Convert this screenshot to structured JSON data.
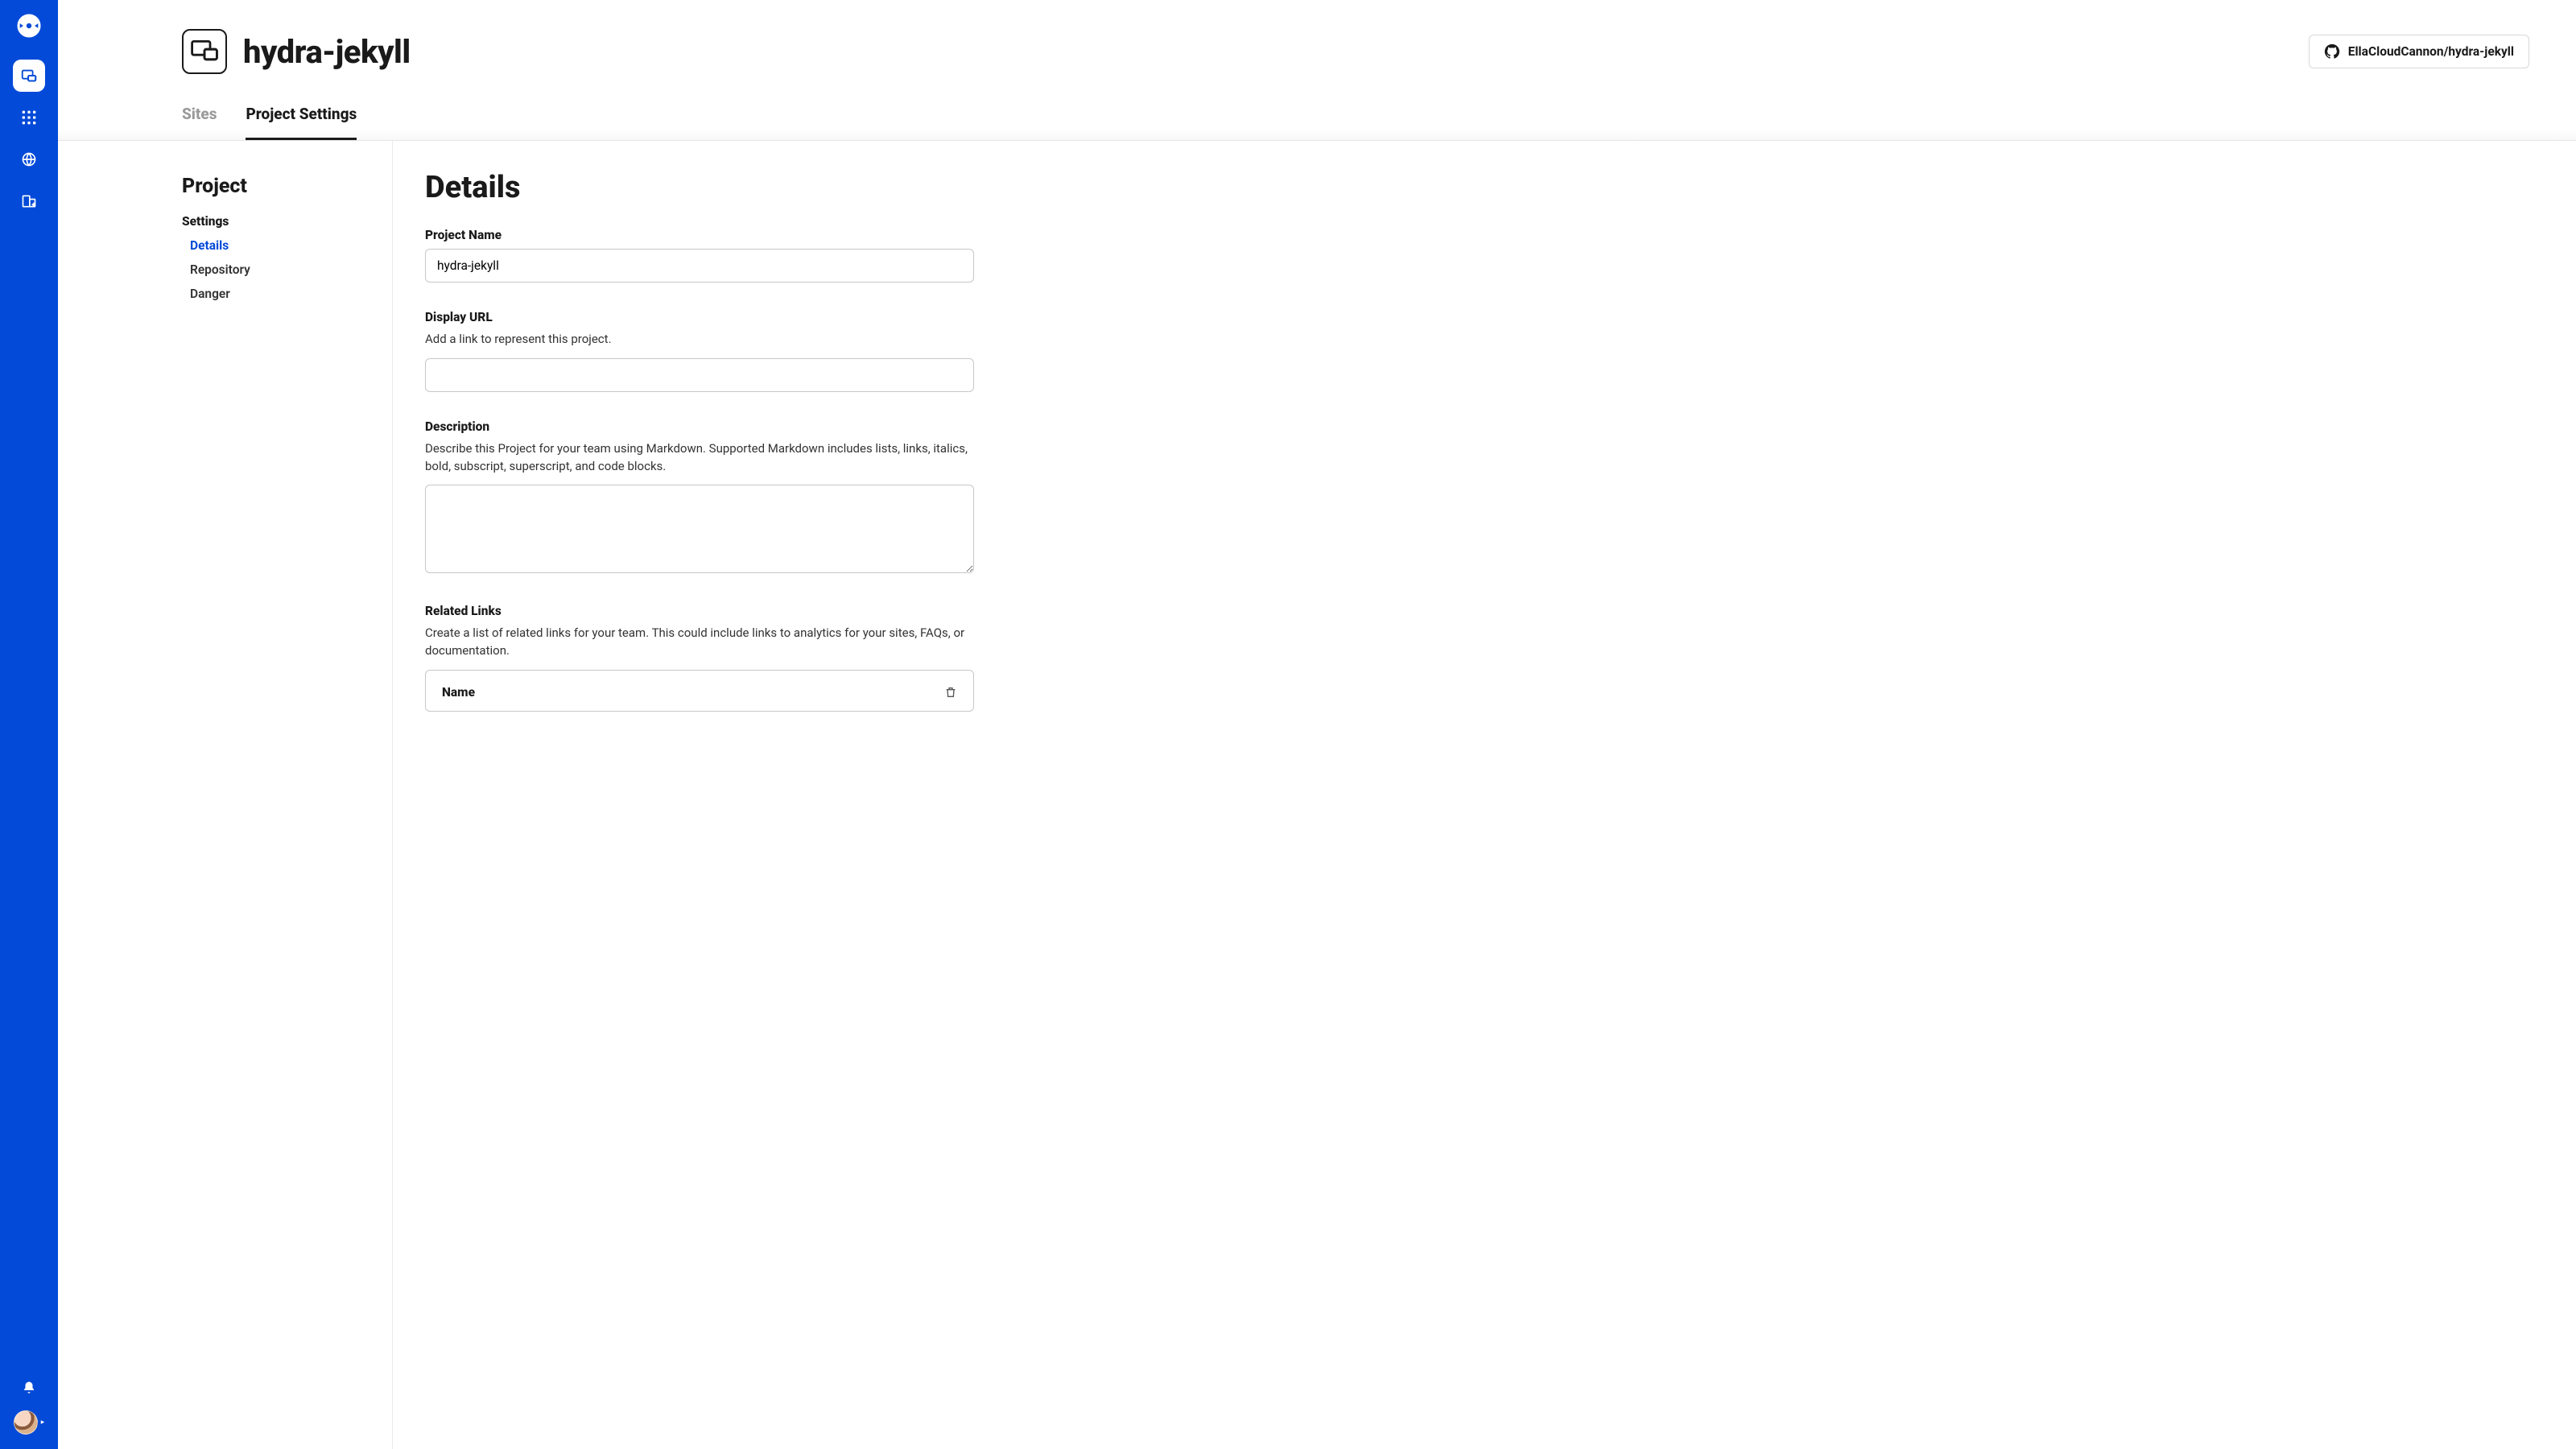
{
  "rail": {
    "items": [
      "projects",
      "apps",
      "domains",
      "org"
    ]
  },
  "header": {
    "project_name": "hydra-jekyll",
    "repo_label": "EllaCloudCannon/hydra-jekyll"
  },
  "tabs": {
    "sites": "Sites",
    "project_settings": "Project Settings"
  },
  "sidepanel": {
    "title": "Project",
    "subtitle": "Settings",
    "items": [
      "Details",
      "Repository",
      "Danger"
    ],
    "active": 0
  },
  "form": {
    "title": "Details",
    "project_name": {
      "label": "Project Name",
      "value": "hydra-jekyll"
    },
    "display_url": {
      "label": "Display URL",
      "help": "Add a link to represent this project.",
      "value": ""
    },
    "description": {
      "label": "Description",
      "help": "Describe this Project for your team using Markdown. Supported Markdown includes lists, links, italics, bold, subscript, superscript, and code blocks.",
      "value": ""
    },
    "related_links": {
      "label": "Related Links",
      "help": "Create a list of related links for your team. This could include links to analytics for your sites, FAQs, or documentation.",
      "item_name_label": "Name"
    }
  }
}
